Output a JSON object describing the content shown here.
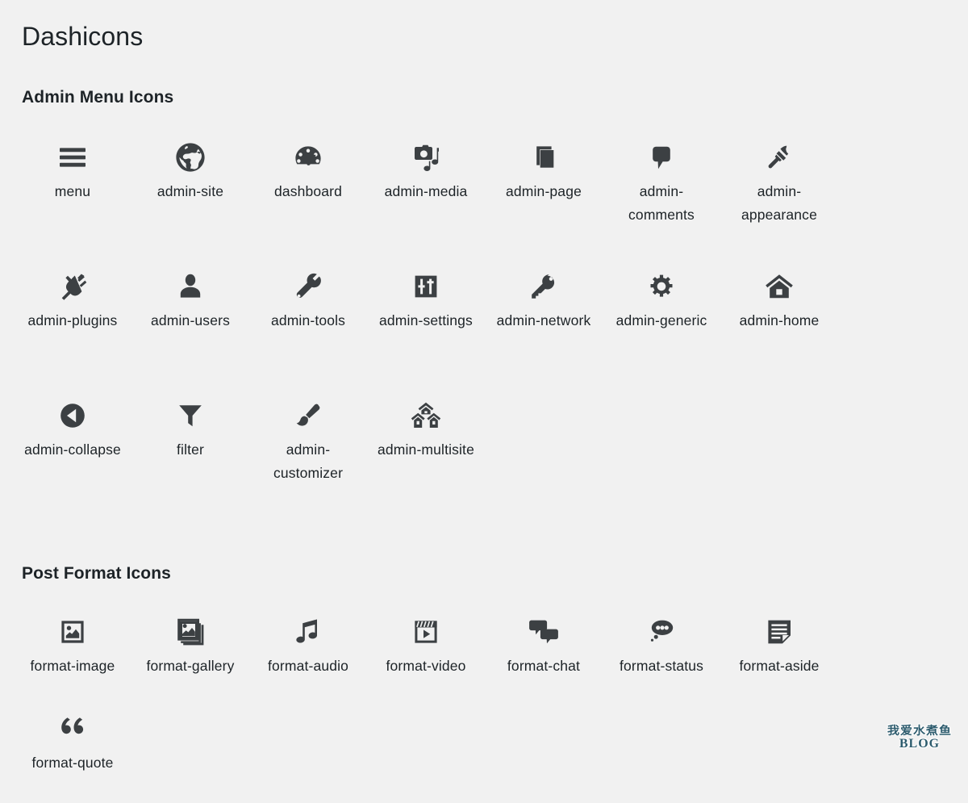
{
  "page": {
    "title": "Dashicons",
    "background_color": "#f1f1f1",
    "icon_color": "#3c4043",
    "text_color": "#1d2327"
  },
  "sections": [
    {
      "id": "admin-menu-icons",
      "title": "Admin Menu Icons",
      "icons": [
        {
          "name": "menu",
          "label": "menu"
        },
        {
          "name": "admin-site",
          "label": "admin-site"
        },
        {
          "name": "dashboard",
          "label": "dashboard"
        },
        {
          "name": "admin-media",
          "label": "admin-media"
        },
        {
          "name": "admin-page",
          "label": "admin-page"
        },
        {
          "name": "admin-comments",
          "label": "admin-comments"
        },
        {
          "name": "admin-appearance",
          "label": "admin-appearance"
        },
        {
          "name": "admin-plugins",
          "label": "admin-plugins"
        },
        {
          "name": "admin-users",
          "label": "admin-users"
        },
        {
          "name": "admin-tools",
          "label": "admin-tools"
        },
        {
          "name": "admin-settings",
          "label": "admin-settings"
        },
        {
          "name": "admin-network",
          "label": "admin-network"
        },
        {
          "name": "admin-generic",
          "label": "admin-generic"
        },
        {
          "name": "admin-home",
          "label": "admin-home"
        },
        {
          "name": "admin-collapse",
          "label": "admin-collapse"
        },
        {
          "name": "filter",
          "label": "filter"
        },
        {
          "name": "admin-customizer",
          "label": "admin-customizer"
        },
        {
          "name": "admin-multisite",
          "label": "admin-multisite"
        }
      ]
    },
    {
      "id": "post-format-icons",
      "title": "Post Format Icons",
      "icons": [
        {
          "name": "format-image",
          "label": "format-image"
        },
        {
          "name": "format-gallery",
          "label": "format-gallery"
        },
        {
          "name": "format-audio",
          "label": "format-audio"
        },
        {
          "name": "format-video",
          "label": "format-video"
        },
        {
          "name": "format-chat",
          "label": "format-chat"
        },
        {
          "name": "format-status",
          "label": "format-status"
        },
        {
          "name": "format-aside",
          "label": "format-aside"
        },
        {
          "name": "format-quote",
          "label": "format-quote"
        }
      ]
    }
  ],
  "watermark": {
    "cn_text": "我爱水煮鱼",
    "en_text": "BLOG",
    "color": "#2e5c6e"
  }
}
